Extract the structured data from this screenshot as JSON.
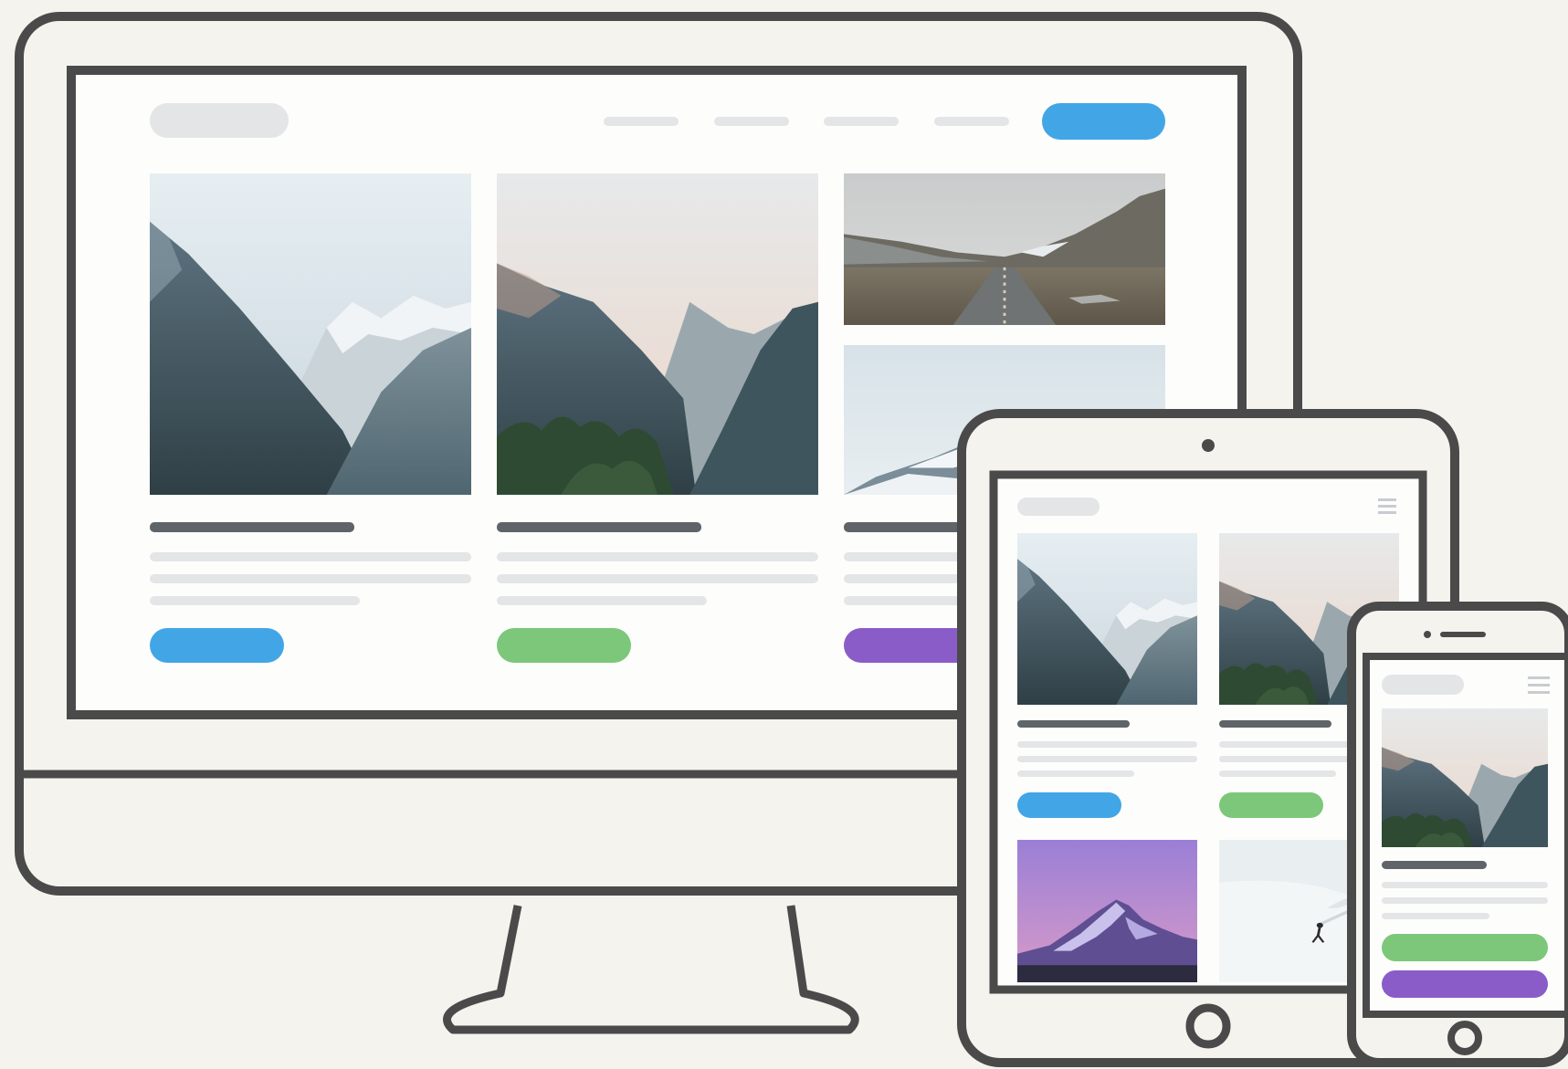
{
  "colors": {
    "background": "#f4f3ee",
    "frame": "#4a4a4a",
    "screen": "#fdfdfc",
    "placeholder_light": "#e3e5e7",
    "placeholder_dark": "#5f6468",
    "button_blue": "#42a6e6",
    "button_green": "#7cc77a",
    "button_purple": "#8a5cc8"
  },
  "devices": {
    "desktop": {
      "nav_links": 4,
      "cards": [
        {
          "image": "mountain-valley-snow",
          "button_color": "blue"
        },
        {
          "image": "mountain-valley-dusk",
          "button_color": "green"
        },
        {
          "image": "mountain-road",
          "button_color": "purple"
        }
      ]
    },
    "tablet": {
      "cards": [
        {
          "image": "mountain-valley-snow",
          "button_color": "blue"
        },
        {
          "image": "mountain-valley-dusk",
          "button_color": "green"
        },
        {
          "image": "purple-peak"
        },
        {
          "image": "snow-skier"
        }
      ]
    },
    "phone": {
      "cards": [
        {
          "image": "mountain-valley-dusk",
          "buttons": [
            "green",
            "purple"
          ]
        }
      ]
    }
  }
}
